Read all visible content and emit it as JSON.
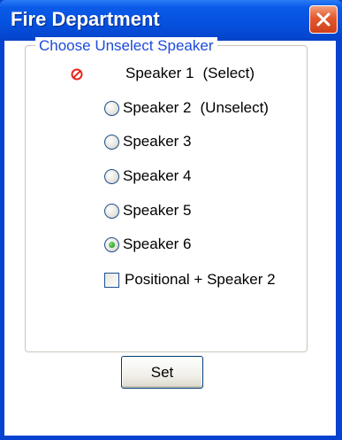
{
  "window": {
    "title": "Fire Department",
    "close_icon": "close-icon"
  },
  "group": {
    "label": "Choose Unselect Speaker"
  },
  "speakers": [
    {
      "label": "Speaker 1",
      "note": "(Select)",
      "state": "selected-elsewhere",
      "icon": "no-select-icon"
    },
    {
      "label": "Speaker 2",
      "note": "(Unselect)",
      "state": "unchecked"
    },
    {
      "label": "Speaker 3",
      "state": "unchecked"
    },
    {
      "label": "Speaker 4",
      "state": "unchecked"
    },
    {
      "label": "Speaker 5",
      "state": "unchecked"
    },
    {
      "label": "Speaker 6",
      "state": "checked"
    }
  ],
  "positional": {
    "label": "Positional + Speaker 2",
    "checked": false
  },
  "set_button": {
    "label": "Set"
  },
  "colors": {
    "titlebar": "#0551df",
    "group_label": "#1c4bd9",
    "no_select_icon": "#e8251c",
    "close_button": "#e2582e"
  }
}
